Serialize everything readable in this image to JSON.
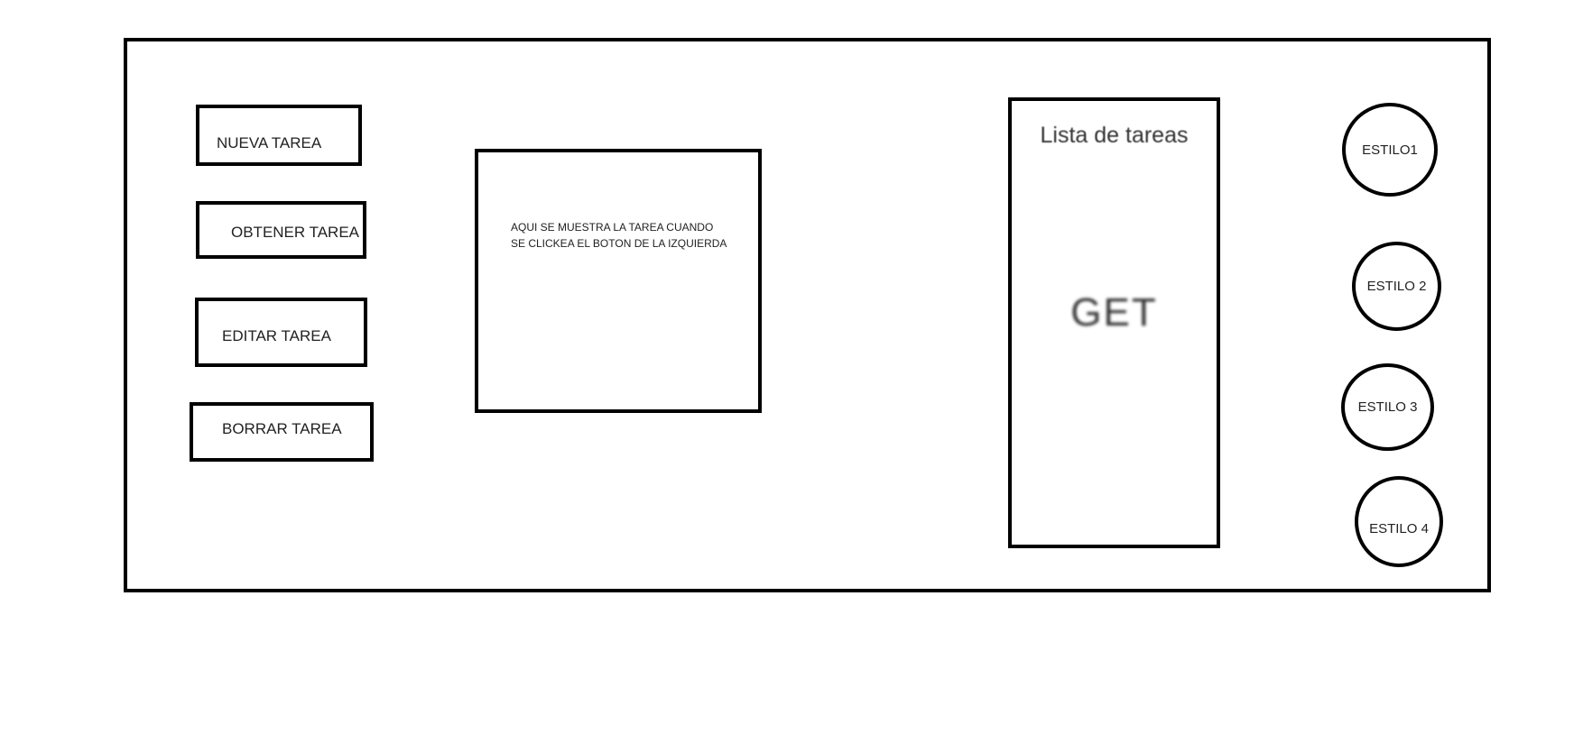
{
  "buttons": {
    "nueva": "NUEVA TAREA",
    "obtener": "OBTENER TAREA",
    "editar": "EDITAR TAREA",
    "borrar": "BORRAR TAREA"
  },
  "display": {
    "text_line1": "AQUI SE MUESTRA LA TAREA CUANDO",
    "text_line2": "SE CLICKEA EL BOTON DE LA IZQUIERDA"
  },
  "task_list": {
    "title": "Lista de tareas",
    "action": "GET"
  },
  "styles": {
    "estilo1": "ESTILO1",
    "estilo2": "ESTILO 2",
    "estilo3": "ESTILO 3",
    "estilo4": "ESTILO 4"
  }
}
